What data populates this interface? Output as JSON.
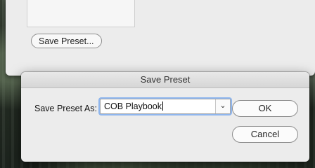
{
  "parent_window": {
    "save_preset_button": "Save Preset..."
  },
  "dialog": {
    "title": "Save Preset",
    "field_label": "Save Preset As:",
    "field_value": "COB Playbook",
    "dropdown_icon": "chevron-down-icon",
    "ok_label": "OK",
    "cancel_label": "Cancel"
  },
  "colors": {
    "focus_ring": "#8fb6ee",
    "dialog_bg": "#ececec"
  }
}
